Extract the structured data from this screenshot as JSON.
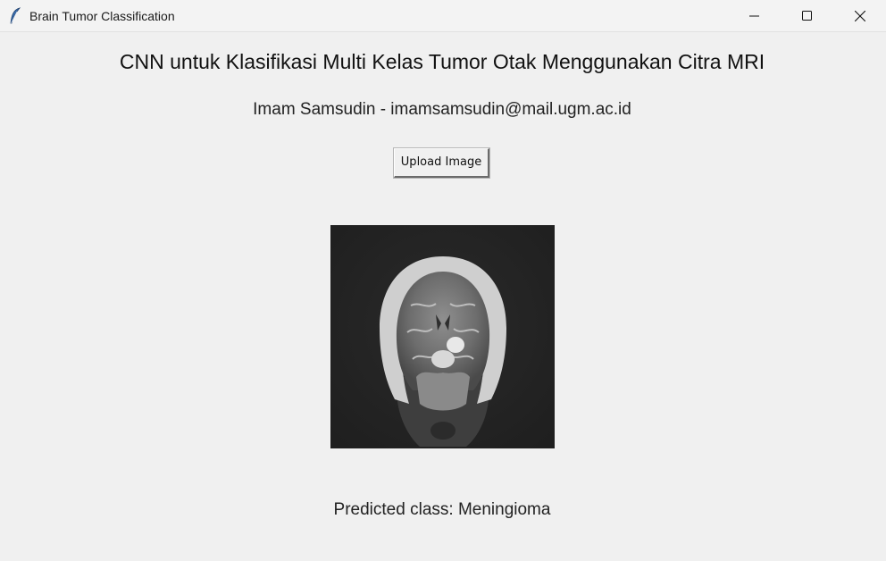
{
  "window": {
    "title": "Brain Tumor Classification",
    "controls": [
      "minimize-icon",
      "maximize-icon",
      "close-icon"
    ]
  },
  "main": {
    "heading": "CNN untuk Klasifikasi Multi Kelas Tumor Otak Menggunakan Citra MRI",
    "author": "Imam Samsudin - imamsamsudin@mail.ugm.ac.id",
    "upload_label": "Upload Image",
    "prediction": "Predicted class: Meningioma"
  }
}
